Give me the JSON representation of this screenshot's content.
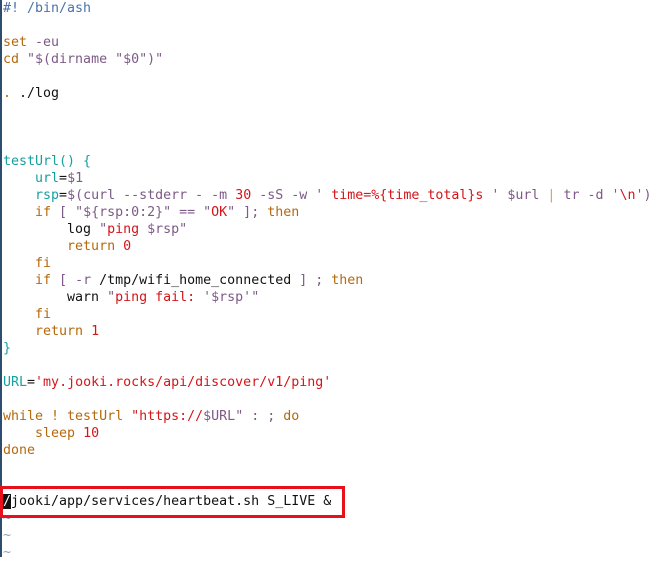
{
  "editor": {
    "lines": [
      [
        [
          "#! /bin/ash",
          "cm"
        ]
      ],
      [],
      [
        [
          "set",
          "kw"
        ],
        [
          " -eu",
          "pu"
        ]
      ],
      [
        [
          "cd",
          "kw"
        ],
        [
          " \"$(dirname \"$0\")\"",
          "pu"
        ]
      ],
      [],
      [
        [
          ".",
          "kw"
        ],
        [
          " ./log",
          "tx"
        ]
      ],
      [],
      [],
      [],
      [
        [
          "testUrl() {",
          "fn"
        ]
      ],
      [
        [
          "    url",
          "fn"
        ],
        [
          "=",
          "tx"
        ],
        [
          "$1",
          "pu"
        ]
      ],
      [
        [
          "    rsp",
          "fn"
        ],
        [
          "=",
          "tx"
        ],
        [
          "$(curl --stderr - -m ",
          "pu"
        ],
        [
          "30",
          "rd"
        ],
        [
          " -sS -w ' ",
          "pu"
        ],
        [
          "time=%{time_total}s",
          "rd"
        ],
        [
          " ' $url ",
          "pu"
        ],
        [
          "|",
          "pipe"
        ],
        [
          " tr -d '",
          "pu"
        ],
        [
          "\\n",
          "rd"
        ],
        [
          "')",
          "pu"
        ]
      ],
      [
        [
          "    if",
          "kw"
        ],
        [
          " [ \"${rsp:0:2}\" == \"",
          "pu"
        ],
        [
          "OK",
          "rd"
        ],
        [
          "\" ]; ",
          "pu"
        ],
        [
          "then",
          "kw"
        ]
      ],
      [
        [
          "        log ",
          "tx"
        ],
        [
          "\"",
          "pu"
        ],
        [
          "ping ",
          "rd"
        ],
        [
          "$rsp",
          "pu"
        ],
        [
          "\"",
          "pu"
        ]
      ],
      [
        [
          "        return ",
          "kw"
        ],
        [
          "0",
          "rd"
        ]
      ],
      [
        [
          "    fi",
          "kw"
        ]
      ],
      [
        [
          "    if",
          "kw"
        ],
        [
          " [ -r ",
          "pu"
        ],
        [
          "/tmp/wifi_home_connected",
          "tx"
        ],
        [
          " ] ; ",
          "pu"
        ],
        [
          "then",
          "kw"
        ]
      ],
      [
        [
          "        warn ",
          "tx"
        ],
        [
          "\"",
          "pu"
        ],
        [
          "ping fail: ",
          "rd"
        ],
        [
          "'$rsp'",
          "pu"
        ],
        [
          "\"",
          "pu"
        ]
      ],
      [
        [
          "    fi",
          "kw"
        ]
      ],
      [
        [
          "    return ",
          "kw"
        ],
        [
          "1",
          "rd"
        ]
      ],
      [
        [
          "}",
          "fn"
        ]
      ],
      [],
      [
        [
          "URL",
          "fn"
        ],
        [
          "=",
          "tx"
        ],
        [
          "'my.jooki.rocks/api/discover/v1/ping'",
          "rd"
        ]
      ],
      [],
      [
        [
          "while ! testUrl ",
          "kw"
        ],
        [
          "\"https://",
          "rd"
        ],
        [
          "$URL",
          "pu"
        ],
        [
          "\"",
          "pu"
        ],
        [
          " : ; ",
          "pu"
        ],
        [
          "do",
          "kw"
        ]
      ],
      [
        [
          "    sleep ",
          "kw"
        ],
        [
          "10",
          "rd"
        ]
      ],
      [
        [
          "done",
          "kw"
        ]
      ],
      [],
      [],
      [
        [
          "/",
          "cur"
        ],
        [
          "jooki/app/services/heartbeat.sh S_LIVE &",
          "tx"
        ]
      ],
      [
        [
          "~",
          "tilde"
        ]
      ],
      [
        [
          "~",
          "tilde"
        ]
      ],
      [
        [
          "~",
          "tilde"
        ]
      ]
    ],
    "highlighted_line": 29,
    "colors": {
      "highlight_box": "#e8101a",
      "keyword": "#b5690c",
      "string": "#d4151a",
      "identifier": "#16a0a0",
      "comment": "#4a72a8"
    }
  }
}
